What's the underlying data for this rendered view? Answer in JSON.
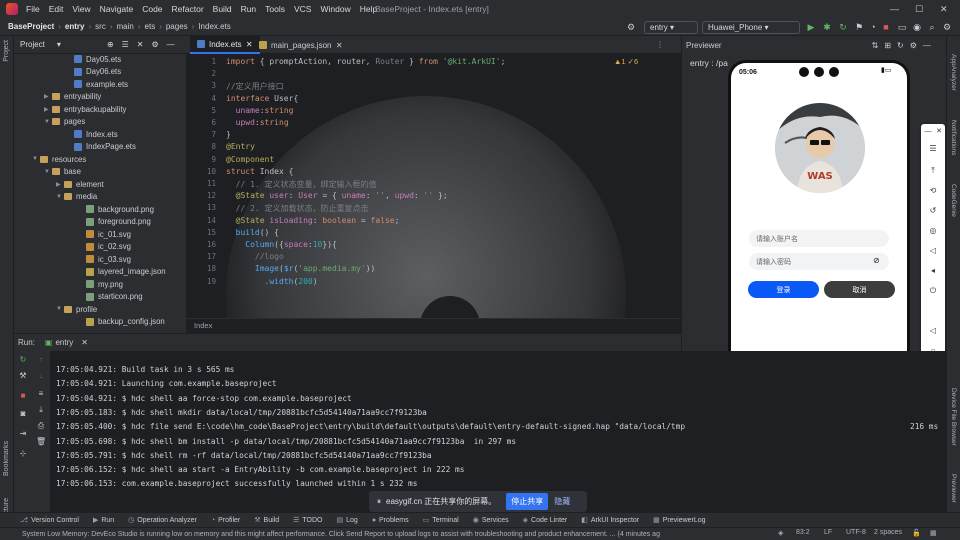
{
  "menubar": {
    "items": [
      "File",
      "Edit",
      "View",
      "Navigate",
      "Code",
      "Refactor",
      "Build",
      "Run",
      "Tools",
      "VCS",
      "Window",
      "Help"
    ],
    "window_title": "BaseProject - Index.ets [entry]"
  },
  "navbar": {
    "crumbs": [
      "BaseProject",
      "entry",
      "src",
      "main",
      "ets",
      "pages",
      "Index.ets"
    ],
    "run_config": "entry",
    "device": "Huawei_Phone"
  },
  "project": {
    "title": "Project",
    "tree": [
      {
        "label": "Day05.ets",
        "type": "ets",
        "indent": 82,
        "arrow": ""
      },
      {
        "label": "Day06.ets",
        "type": "ets",
        "indent": 82,
        "arrow": ""
      },
      {
        "label": "example.ets",
        "type": "ets",
        "indent": 82,
        "arrow": ""
      },
      {
        "label": "entryability",
        "type": "folder",
        "indent": 60,
        "arrow": "▶"
      },
      {
        "label": "entrybackupability",
        "type": "folder",
        "indent": 60,
        "arrow": "▶"
      },
      {
        "label": "pages",
        "type": "folder",
        "indent": 60,
        "arrow": "▼"
      },
      {
        "label": "Index.ets",
        "type": "ets",
        "indent": 82,
        "arrow": ""
      },
      {
        "label": "IndexPage.ets",
        "type": "ets",
        "indent": 82,
        "arrow": ""
      },
      {
        "label": "resources",
        "type": "folder",
        "indent": 48,
        "arrow": "▼"
      },
      {
        "label": "base",
        "type": "folder",
        "indent": 60,
        "arrow": "▼"
      },
      {
        "label": "element",
        "type": "folder",
        "indent": 72,
        "arrow": "▶"
      },
      {
        "label": "media",
        "type": "folder",
        "indent": 72,
        "arrow": "▼"
      },
      {
        "label": "background.png",
        "type": "img",
        "indent": 94,
        "arrow": ""
      },
      {
        "label": "foreground.png",
        "type": "img",
        "indent": 94,
        "arrow": ""
      },
      {
        "label": "ic_01.svg",
        "type": "svg",
        "indent": 94,
        "arrow": ""
      },
      {
        "label": "ic_02.svg",
        "type": "svg",
        "indent": 94,
        "arrow": ""
      },
      {
        "label": "ic_03.svg",
        "type": "svg",
        "indent": 94,
        "arrow": ""
      },
      {
        "label": "layered_image.json",
        "type": "json",
        "indent": 94,
        "arrow": ""
      },
      {
        "label": "my.png",
        "type": "img",
        "indent": 94,
        "arrow": ""
      },
      {
        "label": "starticon.png",
        "type": "img",
        "indent": 94,
        "arrow": ""
      },
      {
        "label": "profile",
        "type": "folder",
        "indent": 72,
        "arrow": "▼"
      },
      {
        "label": "backup_config.json",
        "type": "json",
        "indent": 94,
        "arrow": ""
      }
    ]
  },
  "editor": {
    "tabs": [
      "Index.ets",
      "main_pages.json"
    ],
    "warnings": "▲1 ✓6",
    "footer": "Index",
    "lines": [
      [
        {
          "t": "import",
          "c": "kw"
        },
        {
          "t": " { promptAction, router, ",
          "c": ""
        },
        {
          "t": "Router",
          "c": "cm"
        },
        {
          "t": " } ",
          "c": ""
        },
        {
          "t": "from",
          "c": "kw"
        },
        {
          "t": " '@kit.ArkUI'",
          "c": "str"
        },
        {
          "t": ";",
          "c": ""
        }
      ],
      [],
      [
        {
          "t": "//定义用户接口",
          "c": "cm"
        }
      ],
      [
        {
          "t": "interface",
          "c": "kw"
        },
        {
          "t": " User{",
          "c": ""
        }
      ],
      [
        {
          "t": "  uname",
          "c": "prop"
        },
        {
          "t": ":",
          "c": ""
        },
        {
          "t": "string",
          "c": "kw"
        }
      ],
      [
        {
          "t": "  upwd",
          "c": "prop"
        },
        {
          "t": ":",
          "c": ""
        },
        {
          "t": "string",
          "c": "kw"
        }
      ],
      [
        {
          "t": "}",
          "c": ""
        }
      ],
      [
        {
          "t": "@Entry",
          "c": "dec"
        }
      ],
      [
        {
          "t": "@Component",
          "c": "dec"
        }
      ],
      [
        {
          "t": "struct",
          "c": "kw"
        },
        {
          "t": " Index {",
          "c": ""
        }
      ],
      [
        {
          "t": "  // 1. 定义状态变量，绑定输入框的值",
          "c": "cm"
        }
      ],
      [
        {
          "t": "  @State",
          "c": "dec"
        },
        {
          "t": " user",
          "c": "prop"
        },
        {
          "t": ": ",
          "c": ""
        },
        {
          "t": "User",
          "c": "ty"
        },
        {
          "t": " = { ",
          "c": ""
        },
        {
          "t": "uname",
          "c": "prop"
        },
        {
          "t": ": ",
          "c": ""
        },
        {
          "t": "''",
          "c": "str"
        },
        {
          "t": ", ",
          "c": ""
        },
        {
          "t": "upwd",
          "c": "prop"
        },
        {
          "t": ": ",
          "c": ""
        },
        {
          "t": "''",
          "c": "str"
        },
        {
          "t": " };",
          "c": ""
        }
      ],
      [
        {
          "t": "  // 2. 定义加载状态，防止重复点击",
          "c": "cm"
        }
      ],
      [
        {
          "t": "  @State",
          "c": "dec"
        },
        {
          "t": " isLoading",
          "c": "prop"
        },
        {
          "t": ": ",
          "c": ""
        },
        {
          "t": "boolean",
          "c": "kw"
        },
        {
          "t": " = ",
          "c": ""
        },
        {
          "t": "false",
          "c": "kw"
        },
        {
          "t": ";",
          "c": ""
        }
      ],
      [
        {
          "t": "  build",
          "c": "fn"
        },
        {
          "t": "() {",
          "c": ""
        }
      ],
      [
        {
          "t": "    Column",
          "c": "fn"
        },
        {
          "t": "({",
          "c": ""
        },
        {
          "t": "space",
          "c": "prop"
        },
        {
          "t": ":",
          "c": ""
        },
        {
          "t": "10",
          "c": "num"
        },
        {
          "t": "}){",
          "c": ""
        }
      ],
      [
        {
          "t": "      //logo",
          "c": "cm"
        }
      ],
      [
        {
          "t": "      Image",
          "c": "fn"
        },
        {
          "t": "(",
          "c": ""
        },
        {
          "t": "$r",
          "c": "fn"
        },
        {
          "t": "(",
          "c": ""
        },
        {
          "t": "'app.media.my'",
          "c": "str"
        },
        {
          "t": "))",
          "c": ""
        }
      ],
      [
        {
          "t": "        .width",
          "c": "fn"
        },
        {
          "t": "(",
          "c": ""
        },
        {
          "t": "200",
          "c": "num"
        },
        {
          "t": ")",
          "c": ""
        }
      ]
    ]
  },
  "previewer": {
    "title": "Previewer",
    "page": "entry : /pa",
    "app": {
      "time": "05:06",
      "username_placeholder": "请输入账户名",
      "password_placeholder": "请输入密码",
      "login_label": "登录",
      "cancel_label": "取消",
      "avatar_text": "WAS"
    }
  },
  "run": {
    "label": "Run:",
    "config": "entry",
    "lines": [
      "17:05:04.921: Build task in 3 s 565 ms",
      "17:05:04.921: Launching com.example.baseproject",
      "17:05:04.921: $ hdc shell aa force-stop com.example.baseproject",
      "17:05:05.183: $ hdc shell mkdir data/local/tmp/20881bcfc5d54140a71aa9cc7f9123ba",
      "17:05:05.400: $ hdc file send E:\\code\\hm_code\\BaseProject\\entry\\build\\default\\outputs\\default\\entry-default-signed.hap \"data/local/tmp",
      "17:05:05.698: $ hdc shell bm install -p data/local/tmp/20881bcfc5d54140a71aa9cc7f9123ba  in 297 ms",
      "17:05:05.791: $ hdc shell rm -rf data/local/tmp/20881bcfc5d54140a71aa9cc7f9123ba",
      "17:05:06.152: $ hdc shell aa start -a EntryAbility -b com.example.baseproject in 222 ms",
      "17:05:06.153: com.example.baseproject successfully launched within 1 s 232 ms"
    ],
    "overflow_text": "216 ms"
  },
  "share": {
    "text": "easygif.cn 正在共享你的屏幕。",
    "stop_label": "停止共享",
    "hide_label": "隐藏"
  },
  "toolstrip": [
    "Version Control",
    "Run",
    "Operation Analyzer",
    "Profiler",
    "Build",
    "TODO",
    "Log",
    "Problems",
    "Terminal",
    "Services",
    "Code Linter",
    "ArkUI Inspector",
    "PreviewerLog"
  ],
  "left_labels": [
    "Project",
    "Bookmarks",
    "Structure"
  ],
  "right_labels": [
    "AppAnalyzer",
    "Notifications",
    "CodeGenie",
    "Device File Browser",
    "Previewer"
  ],
  "status": {
    "message": "System Low Memory: DevEco Studio is running low on memory and this might affect performance. Click Send Report to upload logs to assist with troubleshooting and product enhancement. ... (4 minutes ag",
    "position": "83:2",
    "line_sep": "LF",
    "encoding": "UTF-8",
    "indent": "2 spaces"
  }
}
